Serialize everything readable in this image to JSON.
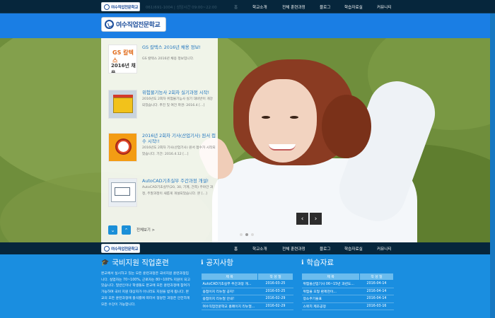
{
  "topbar": {
    "logo_text": "여수직업전문학교",
    "phone": "061)691-1004 | 상담시간 09:00~22:00",
    "nav": [
      "홈",
      "학교소개",
      "전체 훈련과정",
      "블로그",
      "학습자료실",
      "커뮤니티"
    ]
  },
  "header": {
    "logo_text": "여수직업전문학교"
  },
  "news_items": [
    {
      "title": "GS 칼텍스 2016년 채용 정보!",
      "desc": "GS 칼텍스 2016년 채용 정보입니다.",
      "thumb": {
        "brand": "GS 칼텍스",
        "caption": "2016년 채용"
      }
    },
    {
      "title": "위험물기능사 2회차 실기과정 시작!",
      "desc": "2016년도 2회차 위험물기능사 실기 대비반이 개강되었습니다. 추진 및 여건 파견: 2016.4 [...]"
    },
    {
      "title": "2016년 2회차 기사(산업기사) 원서 접수 시작!!",
      "desc": "2016년도 2회차 기사(산업기사) 원서 접수가 시작되었습니다. 기간: 2016.4.12 [...]"
    },
    {
      "title": "AutoCAD기초실무 주간과정 개설!",
      "desc": "AutoCAD기초실무(20, 30, 기계, 건축) 주야간 과정, 주말과정이 새롭게 개설되었습니다. 본 [...]"
    }
  ],
  "slider": {
    "prev_icon": "chevron-up",
    "next_icon": "chevron-up",
    "more_label": "전체보기 >",
    "left_arrow": "‹",
    "right_arrow": "›",
    "dot_count": 3,
    "active_dot": 1
  },
  "bottom_nav": {
    "logo_text": "여수직업전문학교",
    "items": [
      "홈",
      "학교소개",
      "전체 훈련과정",
      "블로그",
      "학습자료실",
      "커뮤니티"
    ]
  },
  "intro": {
    "title": "국비지원 직업훈련",
    "text": "본교에서 실시하고 있는 모든 훈련과정은 국비지원 훈련과정입니다. 실업자는 70~100%, 근로자는 80~100% 지원이 되고 있습니다. 일반인이나 학생들도 본교에 모든 훈련과정에 참여가 가능하며 국비 지원 대상자가 아니라도 지원을 받게 됩니다. 본교의 모든 훈련과정에 출석률에 따라서 정당한 과정은 안전하게 모든 수강이 가능합니다."
  },
  "notices": {
    "title": "공지사항",
    "headers": [
      "제 목",
      "작 성 일"
    ],
    "rows": [
      [
        "AutoCAD기초실무 주간과정 개...",
        "2016-03-25"
      ],
      [
        "용접이지 리뉴얼 공지!",
        "2016-03-25"
      ],
      [
        "용접미지 리뉴얼 안내!",
        "2016-02-29"
      ],
      [
        "여수직업전문학교 홈페이지 리뉴얼...",
        "2016-02-29"
      ]
    ]
  },
  "materials": {
    "title": "학습자료",
    "headers": [
      "제 목",
      "작 성 일"
    ],
    "rows": [
      [
        "위험물산업기사 06~15년 과년도...",
        "2016-04-14"
      ],
      [
        "위험물 모형 환제천이...",
        "2016-04-14"
      ],
      [
        "정소주기율표",
        "2016-04-14"
      ],
      [
        "스위치 제조공정",
        "2016-03-16"
      ]
    ]
  },
  "colors": {
    "accent": "#1a8ee0",
    "dark_bar": "#06263c",
    "banner": "#1a7ee4",
    "link": "#1e73be"
  }
}
